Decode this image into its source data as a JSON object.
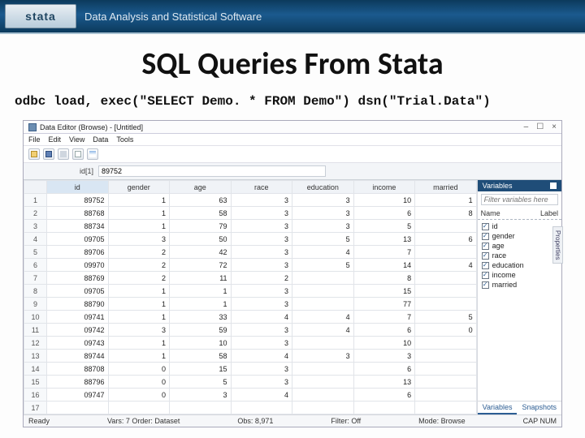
{
  "banner": {
    "logo": "stata",
    "tagline": "Data Analysis and Statistical Software"
  },
  "slide_title": "SQL Queries From Stata",
  "command": "odbc load, exec(\"SELECT Demo. * FROM Demo\") dsn(\"Trial.Data\")",
  "editor": {
    "title": "Data Editor (Browse) - [Untitled]",
    "menus": [
      "File",
      "Edit",
      "View",
      "Data",
      "Tools"
    ],
    "cellref": "id[1]",
    "cellval": "89752",
    "columns": [
      "id",
      "gender",
      "age",
      "race",
      "education",
      "income",
      "married"
    ],
    "rows": [
      [
        "1",
        "89752",
        "1",
        "63",
        "3",
        "3",
        "10",
        "1"
      ],
      [
        "2",
        "88768",
        "1",
        "58",
        "3",
        "3",
        "6",
        "8"
      ],
      [
        "3",
        "88734",
        "1",
        "79",
        "3",
        "3",
        "5",
        ""
      ],
      [
        "4",
        "09705",
        "3",
        "50",
        "3",
        "5",
        "13",
        "6"
      ],
      [
        "5",
        "89706",
        "2",
        "42",
        "3",
        "4",
        "7",
        ""
      ],
      [
        "6",
        "09970",
        "2",
        "72",
        "3",
        "5",
        "14",
        "4"
      ],
      [
        "7",
        "88769",
        "2",
        "11",
        "2",
        "",
        "8",
        ""
      ],
      [
        "8",
        "09705",
        "1",
        "1",
        "3",
        "",
        "15",
        ""
      ],
      [
        "9",
        "88790",
        "1",
        "1",
        "3",
        "",
        "77",
        ""
      ],
      [
        "10",
        "09741",
        "1",
        "33",
        "4",
        "4",
        "7",
        "5"
      ],
      [
        "11",
        "09742",
        "3",
        "59",
        "3",
        "4",
        "6",
        "0"
      ],
      [
        "12",
        "09743",
        "1",
        "10",
        "3",
        "",
        "10",
        ""
      ],
      [
        "13",
        "89744",
        "1",
        "58",
        "4",
        "3",
        "3",
        ""
      ],
      [
        "14",
        "88708",
        "0",
        "15",
        "3",
        "",
        "6",
        ""
      ],
      [
        "15",
        "88796",
        "0",
        "5",
        "3",
        "",
        "13",
        ""
      ],
      [
        "16",
        "09747",
        "0",
        "3",
        "4",
        "",
        "6",
        ""
      ],
      [
        "17",
        "",
        "",
        "",
        "",
        "",
        "",
        ""
      ]
    ],
    "varpanel": {
      "title": "Variables",
      "filter_placeholder": "Filter variables here",
      "header_name": "Name",
      "header_label": "Label",
      "vars": [
        "id",
        "gender",
        "age",
        "race",
        "education",
        "income",
        "married"
      ],
      "tabs": [
        "Variables",
        "Snapshots"
      ]
    },
    "properties_tab": "Properties",
    "status": {
      "ready": "Ready",
      "vars": "Vars: 7  Order: Dataset",
      "obs": "Obs: 8,971",
      "filter": "Filter: Off",
      "mode": "Mode: Browse",
      "caps": "CAP  NUM"
    }
  }
}
